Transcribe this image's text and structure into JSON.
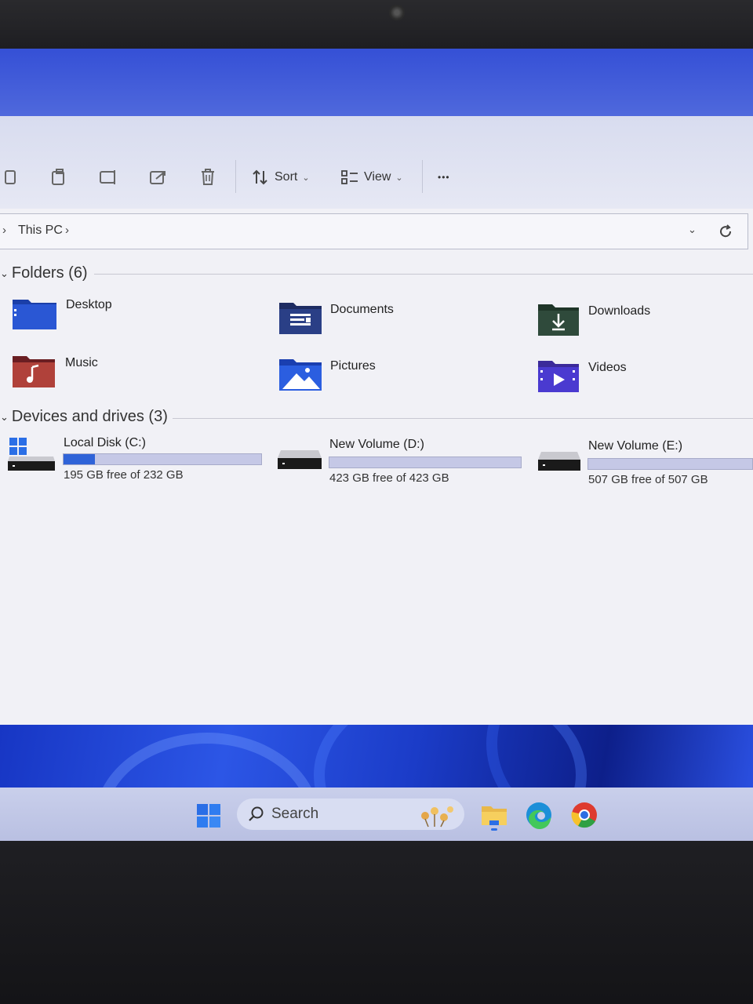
{
  "toolbar": {
    "sort_label": "Sort",
    "view_label": "View",
    "more_label": "•••"
  },
  "address": {
    "crumb": "This PC"
  },
  "folders_section": {
    "title": "Folders (6)",
    "items": [
      {
        "label": "Desktop",
        "icon": "desktop-folder-icon"
      },
      {
        "label": "Documents",
        "icon": "documents-folder-icon"
      },
      {
        "label": "Downloads",
        "icon": "downloads-folder-icon"
      },
      {
        "label": "Music",
        "icon": "music-folder-icon"
      },
      {
        "label": "Pictures",
        "icon": "pictures-folder-icon"
      },
      {
        "label": "Videos",
        "icon": "videos-folder-icon"
      }
    ]
  },
  "drives_section": {
    "title": "Devices and drives (3)",
    "drives": [
      {
        "name": "Local Disk (C:)",
        "free_text": "195 GB free of 232 GB",
        "used_fraction": 0.16
      },
      {
        "name": "New Volume (D:)",
        "free_text": "423 GB free of 423 GB",
        "used_fraction": 0.0
      },
      {
        "name": "New Volume (E:)",
        "free_text": "507 GB free of 507 GB",
        "used_fraction": 0.0
      }
    ]
  },
  "taskbar": {
    "search_label": "Search"
  },
  "colors": {
    "accent": "#2f63d8",
    "window_bg": "#f1f1f6"
  }
}
